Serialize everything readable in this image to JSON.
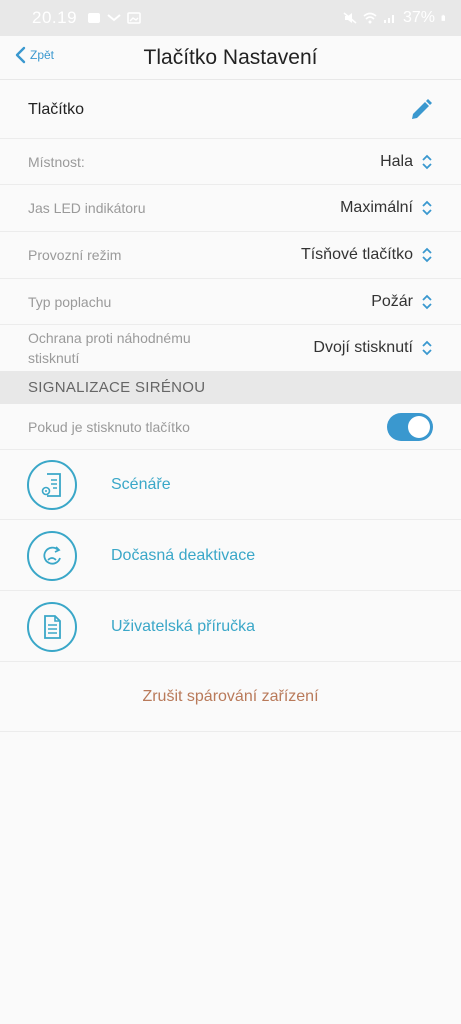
{
  "status_bar": {
    "time": "20.19",
    "battery": "37%"
  },
  "nav": {
    "back_label": "Zpět",
    "title": "Tlačítko Nastavení"
  },
  "device": {
    "name": "Tlačítko"
  },
  "settings": [
    {
      "label": "Místnost:",
      "value": "Hala"
    },
    {
      "label": "Jas LED indikátoru",
      "value": "Maximální"
    },
    {
      "label": "Provozní režim",
      "value": "Tísňové tlačítko"
    },
    {
      "label": "Typ poplachu",
      "value": "Požár"
    },
    {
      "label": "Ochrana proti náhodnému stisknutí",
      "value": "Dvojí stisknutí"
    }
  ],
  "siren": {
    "section_title": "SIGNALIZACE SIRÉNOU",
    "toggle_label": "Pokud je stisknuto tlačítko",
    "toggle_on": true
  },
  "links": [
    {
      "label": "Scénáře",
      "icon": "scenario-icon"
    },
    {
      "label": "Dočasná deaktivace",
      "icon": "deactivate-icon"
    },
    {
      "label": "Uživatelská příručka",
      "icon": "manual-icon"
    }
  ],
  "unpair_label": "Zrušit spárování zařízení",
  "colors": {
    "accent": "#3a98cf",
    "link": "#3aa7c8",
    "danger": "#b97a5a"
  }
}
